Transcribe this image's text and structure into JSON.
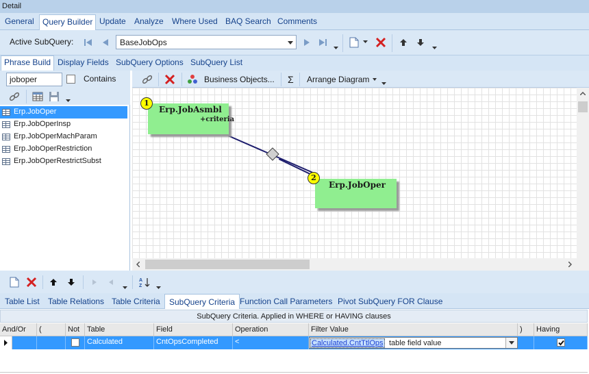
{
  "window": {
    "title": "Detail"
  },
  "main_tabs": [
    "General",
    "Query Builder",
    "Update",
    "Analyze",
    "Where Used",
    "BAQ Search",
    "Comments"
  ],
  "subquery_toolbar": {
    "label": "Active SubQuery:",
    "value": "BaseJobOps"
  },
  "sub_tabs": [
    "Phrase Build",
    "Display Fields",
    "SubQuery Options",
    "SubQuery List"
  ],
  "search": {
    "value": "joboper",
    "contains_label": "Contains"
  },
  "table_list": [
    {
      "name": "Erp.JobOper",
      "selected": true
    },
    {
      "name": "Erp.JobOperInsp",
      "selected": false
    },
    {
      "name": "Erp.JobOperMachParam",
      "selected": false
    },
    {
      "name": "Erp.JobOperRestriction",
      "selected": false
    },
    {
      "name": "Erp.JobOperRestrictSubst",
      "selected": false
    }
  ],
  "diagram_toolbar": {
    "business_objects": "Business Objects...",
    "sigma": "Σ",
    "arrange": "Arrange Diagram"
  },
  "diagram": {
    "node1": {
      "badge": "1",
      "title": "Erp.JobAsmbl",
      "subtitle": "+criteria"
    },
    "node2": {
      "badge": "2",
      "title": "Erp.JobOper"
    }
  },
  "bottom_tabs": [
    "Table List",
    "Table Relations",
    "Table Criteria",
    "SubQuery Criteria",
    "Function Call Parameters",
    "Pivot SubQuery FOR Clause"
  ],
  "criteria_grid": {
    "caption": "SubQuery Criteria. Applied in WHERE or HAVING clauses",
    "columns": [
      "And/Or",
      "(",
      "Not",
      "Table",
      "Field",
      "Operation",
      "Filter Value",
      ")",
      "Having"
    ],
    "row": {
      "andor": "",
      "paren_open": "",
      "not": false,
      "table": "Calculated",
      "field": "CntOpsCompleted",
      "operation": "<",
      "filter_link": "Calculated.CntTtlOps",
      "filter_desc": "table field value",
      "paren_close": "",
      "having": true
    }
  },
  "colors": {
    "accent": "#3399ff",
    "node_fill": "#90ee90",
    "badge": "#ffff00",
    "toolbar": "#dae8f6",
    "delete_red": "#d42020"
  }
}
